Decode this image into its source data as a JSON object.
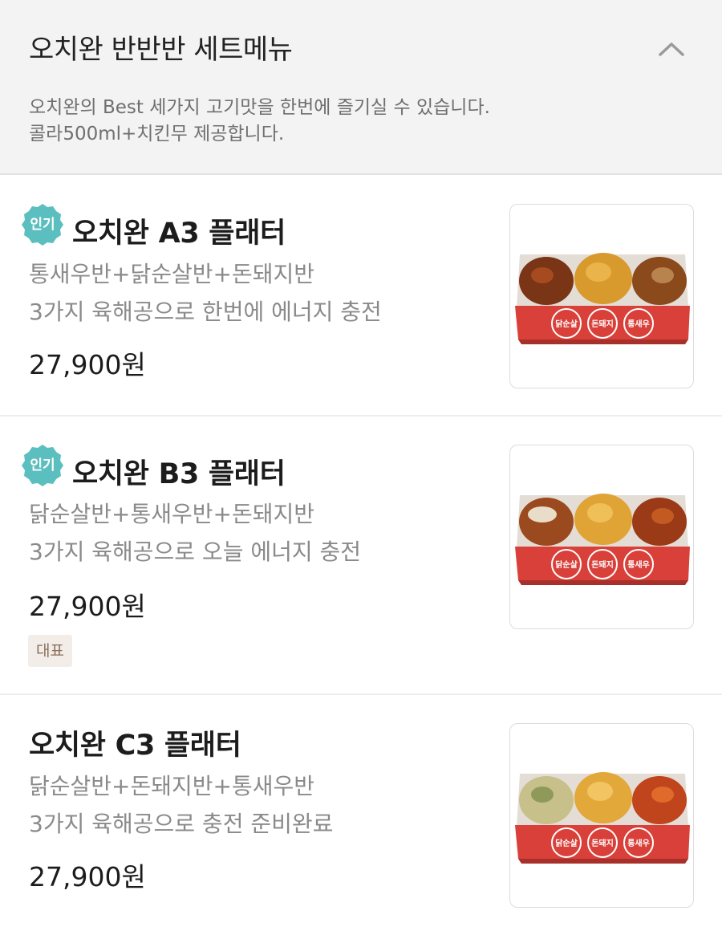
{
  "header": {
    "title": "오치완 반반반 세트메뉴",
    "desc_line1": "오치완의 Best  세가지 고기맛을 한번에 즐기실 수 있습니다.",
    "desc_line2": "콜라500ml+치킨무 제공합니다.",
    "collapse_icon": "chevron-up-icon"
  },
  "badge_color": "#5cbfbf",
  "accent_box_color": "#d9403a",
  "items": [
    {
      "badge": "인기",
      "name": "오치완 A3 플래터",
      "desc1": "통새우반+닭순살반+돈돼지반",
      "desc2": "3가지 육해공으로 한번에 에너지 충전",
      "price": "27,900원",
      "box_labels": [
        "닭순살",
        "돈돼지",
        "통새우"
      ]
    },
    {
      "badge": "인기",
      "name": "오치완 B3 플래터",
      "desc1": "닭순살반+통새우반+돈돼지반",
      "desc2": "3가지 육해공으로 오늘 에너지 충전",
      "price": "27,900원",
      "tag": "대표",
      "box_labels": [
        "닭순살",
        "돈돼지",
        "통새우"
      ]
    },
    {
      "name": "오치완 C3 플래터",
      "desc1": "닭순살반+돈돼지반+통새우반",
      "desc2": "3가지 육해공으로 충전 준비완료",
      "price": "27,900원",
      "box_labels": [
        "닭순살",
        "돈돼지",
        "통새우"
      ]
    }
  ]
}
